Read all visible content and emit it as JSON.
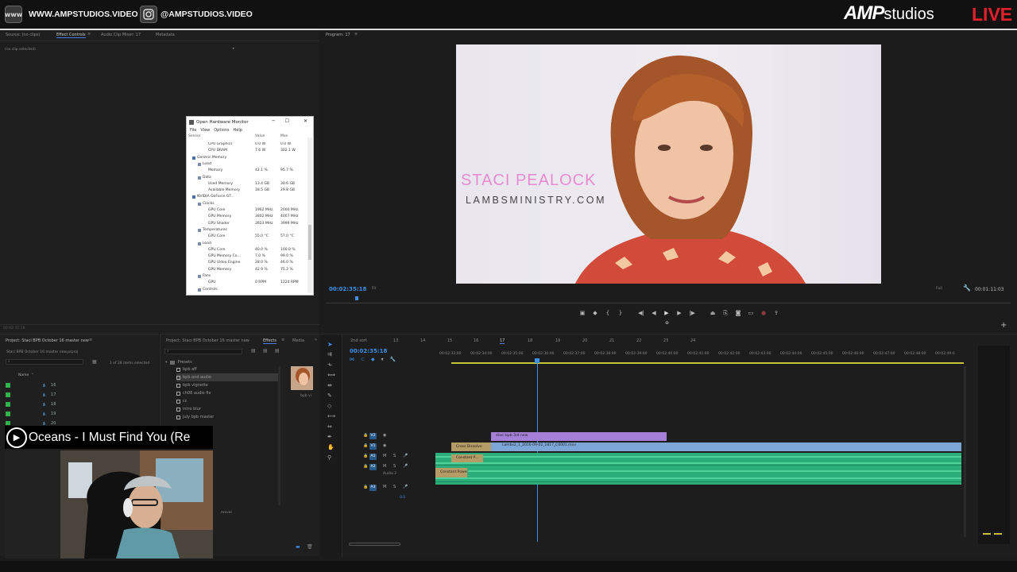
{
  "banner": {
    "website_icon": "www",
    "website": "WWW.AMPSTUDIOS.VIDEO",
    "instagram_icon": "instagram-icon",
    "instagram": "@AMPSTUDIOS.VIDEO",
    "brand_amp": "AMP",
    "brand_studios": "studios",
    "live": "LIVE"
  },
  "source_panel": {
    "tabs": [
      "Source: (no clips)",
      "Effect Controls",
      "Audio Clip Mixer: 17",
      "Metadata"
    ],
    "active_tab": "Effect Controls",
    "no_clip": "(no clip selected)",
    "timecode": "00:02:35:18"
  },
  "hardware_monitor": {
    "title": "Open Hardware Monitor",
    "menu": [
      "File",
      "View",
      "Options",
      "Help"
    ],
    "headers": {
      "sensor": "Sensor",
      "value": "Value",
      "max": "Max"
    },
    "rows": [
      {
        "label": "CPU Graphics",
        "value": "0.0 W",
        "max": "0.0 W",
        "indent": 3
      },
      {
        "label": "CPU DRAM",
        "value": "7.6 W",
        "max": "302.1 W",
        "indent": 3
      },
      {
        "label": "Generic Memory",
        "value": "",
        "max": "",
        "indent": 1
      },
      {
        "label": "Load",
        "value": "",
        "max": "",
        "indent": 2
      },
      {
        "label": "Memory",
        "value": "42.1 %",
        "max": "95.7 %",
        "indent": 3
      },
      {
        "label": "Data",
        "value": "",
        "max": "",
        "indent": 2
      },
      {
        "label": "Used Memory",
        "value": "13.4 GB",
        "max": "30.6 GB",
        "indent": 3
      },
      {
        "label": "Available Memory",
        "value": "18.5 GB",
        "max": "29.8 GB",
        "indent": 3
      },
      {
        "label": "NVIDIA GeForce GT...",
        "value": "",
        "max": "",
        "indent": 1
      },
      {
        "label": "Clocks",
        "value": "",
        "max": "",
        "indent": 2
      },
      {
        "label": "GPU Core",
        "value": "1962 MHz",
        "max": "2000 MHz",
        "indent": 3
      },
      {
        "label": "GPU Memory",
        "value": "3802 MHz",
        "max": "4007 MHz",
        "indent": 3
      },
      {
        "label": "GPU Shader",
        "value": "3923 MHz",
        "max": "3999 MHz",
        "indent": 3
      },
      {
        "label": "Temperatures",
        "value": "",
        "max": "",
        "indent": 2
      },
      {
        "label": "GPU Core",
        "value": "55.0 °C",
        "max": "57.0 °C",
        "indent": 3
      },
      {
        "label": "Load",
        "value": "",
        "max": "",
        "indent": 2
      },
      {
        "label": "GPU Core",
        "value": "40.0 %",
        "max": "100.0 %",
        "indent": 3
      },
      {
        "label": "GPU Memory Co...",
        "value": "7.0 %",
        "max": "99.0 %",
        "indent": 3
      },
      {
        "label": "GPU Video Engine",
        "value": "28.0 %",
        "max": "46.0 %",
        "indent": 3
      },
      {
        "label": "GPU Memory",
        "value": "42.9 %",
        "max": "75.2 %",
        "indent": 3
      },
      {
        "label": "Fans",
        "value": "",
        "max": "",
        "indent": 2
      },
      {
        "label": "GPU",
        "value": "0 RPM",
        "max": "1224 RPM",
        "indent": 3
      },
      {
        "label": "Controls",
        "value": "",
        "max": "",
        "indent": 2
      }
    ]
  },
  "program": {
    "tab": "Program: 17",
    "name": "STACI PEALOCK",
    "url": "LAMBSMINISTRY.COM",
    "timecode": "00:02:35:18",
    "fit": "Fit",
    "quality": "Full",
    "duration": "00:01:11:03",
    "controls": [
      "◀|",
      "▶",
      "|▶"
    ]
  },
  "project": {
    "title": "Project: Staci BPB October 16 master new",
    "file": "Staci BPB October 16 master new.prproj",
    "selection": "1 of 28 items selected",
    "name_header": "Name",
    "items": [
      "16",
      "17",
      "18",
      "19",
      "20"
    ]
  },
  "effects": {
    "tabs": [
      "Project: Staci BPB October 16 master new",
      "Effects",
      "Media"
    ],
    "presets_label": "Presets",
    "items": [
      "bpb aff",
      "bpb end audio",
      "bpb vignette",
      "ch08 audio fix",
      "cc",
      "intro blur",
      "July bpb master"
    ],
    "thumb_caption": "bpb vi",
    "extra": "moval"
  },
  "timeline": {
    "tabs": [
      "2nd sort",
      "13",
      "14",
      "15",
      "16",
      "17",
      "18",
      "19",
      "20",
      "21",
      "22",
      "23",
      "24"
    ],
    "timecode": "00:02:35:18",
    "ruler": [
      "00:02:33:00",
      "00:02:34:00",
      "00:02:35:00",
      "00:02:36:00",
      "00:02:37:00",
      "00:02:38:00",
      "00:02:39:00",
      "00:02:40:00",
      "00:02:41:00",
      "00:02:42:00",
      "00:02:43:00",
      "00:02:44:00",
      "00:02:45:00",
      "00:02:46:00",
      "00:02:47:00",
      "00:02:48:00",
      "00:02:49:0"
    ],
    "tracks": [
      "V2",
      "V1",
      "A1",
      "A2",
      "A3"
    ],
    "clips": {
      "title_clip": "staci bpb 3rd new",
      "video_clip": "Lambs2_1_2016-09-02_1817_C0001.mov",
      "cross_dissolve": "Cross Dissolve",
      "constant_power_1": "Constant P...",
      "constant_power_2": "Constant Power",
      "audio2": "Audio 2",
      "a3_level": "0.0"
    }
  },
  "now_playing": {
    "text": "Oceans - I Must Find You (Re"
  },
  "colors": {
    "accent_blue": "#3f8fe8",
    "live_red": "#e2202b",
    "clip_purple": "#a67fd8",
    "clip_video_blue": "#7da6d8",
    "audio_green": "#2cae7a"
  }
}
